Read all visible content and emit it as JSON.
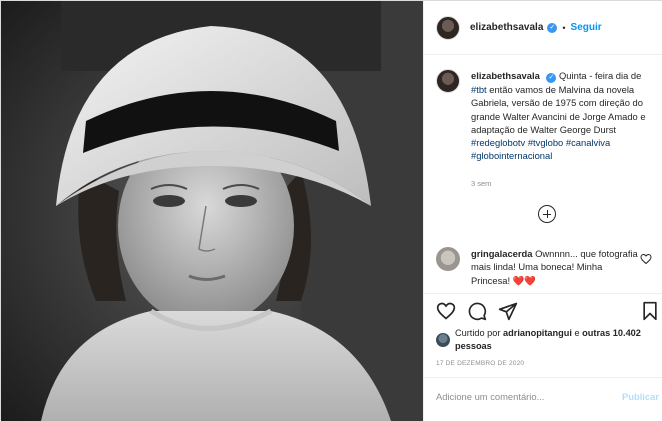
{
  "post": {
    "username": "elizabethsavala",
    "follow_label": "Seguir",
    "dot": "•",
    "verified_mark": "✓",
    "caption_text": "Quinta - feira dia de",
    "tag_tbt": "#tbt",
    "caption_text_2": "então vamos de Malvina da novela Gabriela, versão de 1975 com direção do grande Walter Avancini de Jorge Amado e adaptação de Walter George Durst",
    "tag_redeglobotv": "#redeglobotv",
    "tag_tvglobo": "#tvglobo",
    "tag_canalviva": "#canalviva",
    "tag_globointernacional": "#globointernacional",
    "time_ago": "3 sem",
    "comment": {
      "username": "gringalacerda",
      "text": "Ownnnn... que fotografia mais linda! Uma boneca! Minha Princesa!",
      "hearts": "❤️❤️"
    },
    "likes": {
      "prefix": "Curtido por",
      "user": "adrianopitangui",
      "connector": "e",
      "others": "outras 10.402 pessoas"
    },
    "date": "17 DE DEZEMBRO DE 2020",
    "add_comment_placeholder": "Adicione um comentário...",
    "publish_label": "Publicar"
  },
  "icons": [
    "verified-badge-icon",
    "load-more-comments-icon",
    "like-heart-icon",
    "comment-icon",
    "share-icon",
    "save-bookmark-icon",
    "comment-like-heart-icon"
  ],
  "colors": {
    "link": "#0095f6",
    "hashtag": "#00376b",
    "muted": "#8e8e8e",
    "verified": "#3897f0",
    "heart": "#e0245e"
  }
}
